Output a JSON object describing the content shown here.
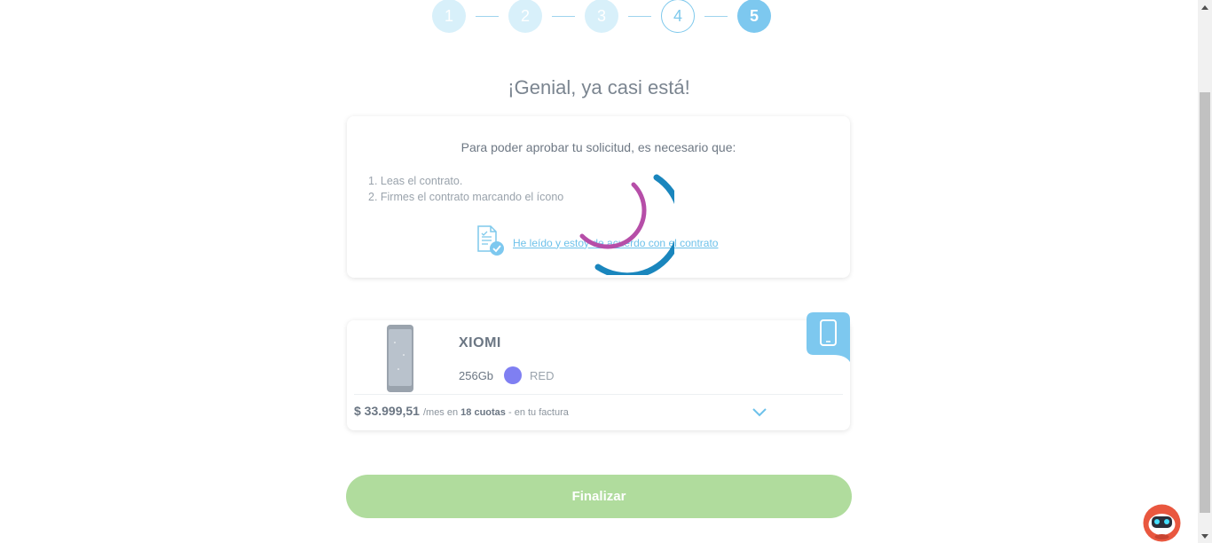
{
  "stepper": {
    "steps": [
      "1",
      "2",
      "3",
      "4",
      "5"
    ],
    "current_step": "5"
  },
  "title": "¡Genial, ya casi está!",
  "contract": {
    "intro": "Para poder aprobar tu solicitud, es necesario que:",
    "steps": [
      "1. Leas el contrato.",
      "2. Firmes el contrato marcando el ícono"
    ],
    "link_label": "He leído y estoy de acuerdo con el contrato",
    "icon": "document-check-icon"
  },
  "spinner": {
    "icon": "loading-spinner-icon",
    "colors": [
      "#b64ea8",
      "#1a86bd"
    ]
  },
  "product": {
    "name": "XIOMI",
    "storage": "256Gb",
    "color_name": "RED",
    "color_swatch": "#7f7ff2",
    "price": "$ 33.999,51",
    "price_suffix_pre": "/mes en",
    "installments": "18 cuotas",
    "price_suffix_post": "- en tu factura",
    "badge_icon": "smartphone-icon"
  },
  "actions": {
    "finish_label": "Finalizar"
  },
  "colors": {
    "accent": "#7dc8ef",
    "button": "#b0dc9d",
    "link": "#6dc1ea"
  }
}
